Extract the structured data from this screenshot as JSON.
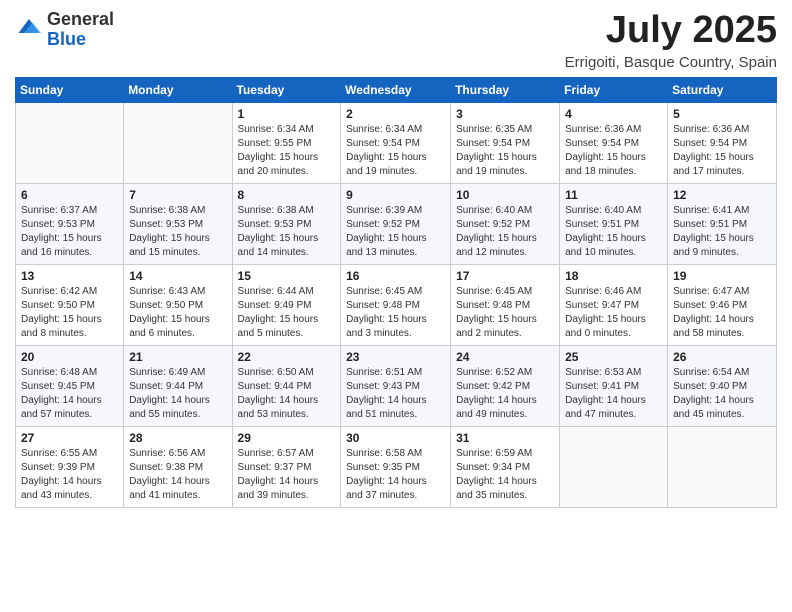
{
  "logo": {
    "general": "General",
    "blue": "Blue"
  },
  "header": {
    "month": "July 2025",
    "location": "Errigoiti, Basque Country, Spain"
  },
  "weekdays": [
    "Sunday",
    "Monday",
    "Tuesday",
    "Wednesday",
    "Thursday",
    "Friday",
    "Saturday"
  ],
  "weeks": [
    [
      {
        "day": "",
        "info": ""
      },
      {
        "day": "",
        "info": ""
      },
      {
        "day": "1",
        "info": "Sunrise: 6:34 AM\nSunset: 9:55 PM\nDaylight: 15 hours and 20 minutes."
      },
      {
        "day": "2",
        "info": "Sunrise: 6:34 AM\nSunset: 9:54 PM\nDaylight: 15 hours and 19 minutes."
      },
      {
        "day": "3",
        "info": "Sunrise: 6:35 AM\nSunset: 9:54 PM\nDaylight: 15 hours and 19 minutes."
      },
      {
        "day": "4",
        "info": "Sunrise: 6:36 AM\nSunset: 9:54 PM\nDaylight: 15 hours and 18 minutes."
      },
      {
        "day": "5",
        "info": "Sunrise: 6:36 AM\nSunset: 9:54 PM\nDaylight: 15 hours and 17 minutes."
      }
    ],
    [
      {
        "day": "6",
        "info": "Sunrise: 6:37 AM\nSunset: 9:53 PM\nDaylight: 15 hours and 16 minutes."
      },
      {
        "day": "7",
        "info": "Sunrise: 6:38 AM\nSunset: 9:53 PM\nDaylight: 15 hours and 15 minutes."
      },
      {
        "day": "8",
        "info": "Sunrise: 6:38 AM\nSunset: 9:53 PM\nDaylight: 15 hours and 14 minutes."
      },
      {
        "day": "9",
        "info": "Sunrise: 6:39 AM\nSunset: 9:52 PM\nDaylight: 15 hours and 13 minutes."
      },
      {
        "day": "10",
        "info": "Sunrise: 6:40 AM\nSunset: 9:52 PM\nDaylight: 15 hours and 12 minutes."
      },
      {
        "day": "11",
        "info": "Sunrise: 6:40 AM\nSunset: 9:51 PM\nDaylight: 15 hours and 10 minutes."
      },
      {
        "day": "12",
        "info": "Sunrise: 6:41 AM\nSunset: 9:51 PM\nDaylight: 15 hours and 9 minutes."
      }
    ],
    [
      {
        "day": "13",
        "info": "Sunrise: 6:42 AM\nSunset: 9:50 PM\nDaylight: 15 hours and 8 minutes."
      },
      {
        "day": "14",
        "info": "Sunrise: 6:43 AM\nSunset: 9:50 PM\nDaylight: 15 hours and 6 minutes."
      },
      {
        "day": "15",
        "info": "Sunrise: 6:44 AM\nSunset: 9:49 PM\nDaylight: 15 hours and 5 minutes."
      },
      {
        "day": "16",
        "info": "Sunrise: 6:45 AM\nSunset: 9:48 PM\nDaylight: 15 hours and 3 minutes."
      },
      {
        "day": "17",
        "info": "Sunrise: 6:45 AM\nSunset: 9:48 PM\nDaylight: 15 hours and 2 minutes."
      },
      {
        "day": "18",
        "info": "Sunrise: 6:46 AM\nSunset: 9:47 PM\nDaylight: 15 hours and 0 minutes."
      },
      {
        "day": "19",
        "info": "Sunrise: 6:47 AM\nSunset: 9:46 PM\nDaylight: 14 hours and 58 minutes."
      }
    ],
    [
      {
        "day": "20",
        "info": "Sunrise: 6:48 AM\nSunset: 9:45 PM\nDaylight: 14 hours and 57 minutes."
      },
      {
        "day": "21",
        "info": "Sunrise: 6:49 AM\nSunset: 9:44 PM\nDaylight: 14 hours and 55 minutes."
      },
      {
        "day": "22",
        "info": "Sunrise: 6:50 AM\nSunset: 9:44 PM\nDaylight: 14 hours and 53 minutes."
      },
      {
        "day": "23",
        "info": "Sunrise: 6:51 AM\nSunset: 9:43 PM\nDaylight: 14 hours and 51 minutes."
      },
      {
        "day": "24",
        "info": "Sunrise: 6:52 AM\nSunset: 9:42 PM\nDaylight: 14 hours and 49 minutes."
      },
      {
        "day": "25",
        "info": "Sunrise: 6:53 AM\nSunset: 9:41 PM\nDaylight: 14 hours and 47 minutes."
      },
      {
        "day": "26",
        "info": "Sunrise: 6:54 AM\nSunset: 9:40 PM\nDaylight: 14 hours and 45 minutes."
      }
    ],
    [
      {
        "day": "27",
        "info": "Sunrise: 6:55 AM\nSunset: 9:39 PM\nDaylight: 14 hours and 43 minutes."
      },
      {
        "day": "28",
        "info": "Sunrise: 6:56 AM\nSunset: 9:38 PM\nDaylight: 14 hours and 41 minutes."
      },
      {
        "day": "29",
        "info": "Sunrise: 6:57 AM\nSunset: 9:37 PM\nDaylight: 14 hours and 39 minutes."
      },
      {
        "day": "30",
        "info": "Sunrise: 6:58 AM\nSunset: 9:35 PM\nDaylight: 14 hours and 37 minutes."
      },
      {
        "day": "31",
        "info": "Sunrise: 6:59 AM\nSunset: 9:34 PM\nDaylight: 14 hours and 35 minutes."
      },
      {
        "day": "",
        "info": ""
      },
      {
        "day": "",
        "info": ""
      }
    ]
  ]
}
